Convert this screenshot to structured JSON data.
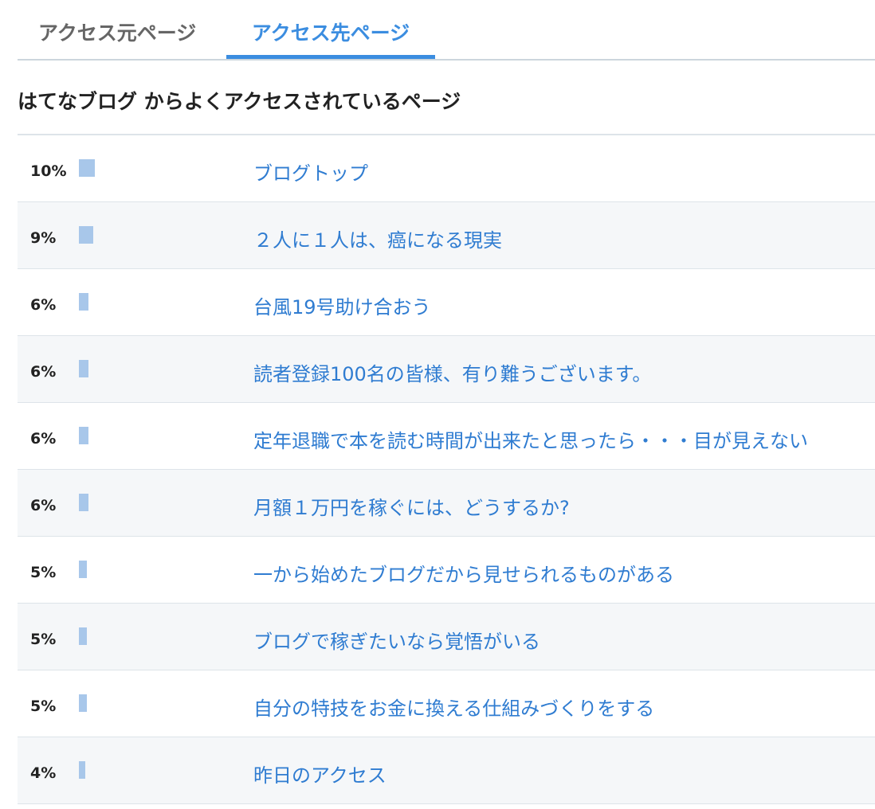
{
  "tabs": {
    "source_label": "アクセス元ページ",
    "dest_label": "アクセス先ページ"
  },
  "heading": "はてなブログ からよくアクセスされているページ",
  "bar_color": "#a8c7ea",
  "link_color": "#2f7cd1",
  "active_tab_color": "#3b8de0",
  "rows": [
    {
      "percent": "10%",
      "share": 10,
      "title": "ブログトップ"
    },
    {
      "percent": "9%",
      "share": 9,
      "title": "２人に１人は、癌になる現実"
    },
    {
      "percent": "6%",
      "share": 6,
      "title": "台風19号助け合おう"
    },
    {
      "percent": "6%",
      "share": 6,
      "title": "読者登録100名の皆様、有り難うございます。"
    },
    {
      "percent": "6%",
      "share": 6,
      "title": "定年退職で本を読む時間が出来たと思ったら・・・目が見えない"
    },
    {
      "percent": "6%",
      "share": 6,
      "title": "月額１万円を稼ぐには、どうするか?"
    },
    {
      "percent": "5%",
      "share": 5,
      "title": "一から始めたブログだから見せられるものがある"
    },
    {
      "percent": "5%",
      "share": 5,
      "title": "ブログで稼ぎたいなら覚悟がいる"
    },
    {
      "percent": "5%",
      "share": 5,
      "title": "自分の特技をお金に換える仕組みづくりをする"
    },
    {
      "percent": "4%",
      "share": 4,
      "title": "昨日のアクセス"
    }
  ]
}
